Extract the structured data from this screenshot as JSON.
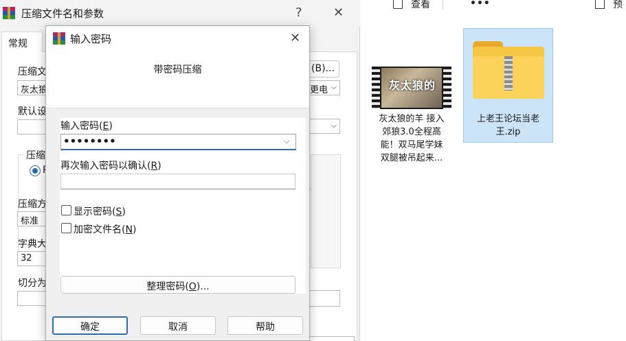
{
  "explorer": {
    "toolbar": {
      "view_label": "查看",
      "more_label": "•••",
      "preview_label": "预"
    },
    "files": [
      {
        "name": "灰太狼的羊 接入郊狼3.0全程高能！双马尾学妹双腿被吊起来...",
        "lines": [
          "灰太狼的羊 接入",
          "郊狼3.0全程高",
          "能！双马尾学妹",
          "双腿被吊起来..."
        ],
        "thumb_text": "灰太狼的"
      },
      {
        "name": "上老王论坛当老王.zip",
        "lines": [
          "上老王论坛当老",
          "王.zip"
        ],
        "selected": true
      }
    ]
  },
  "archive_dialog": {
    "title": "压缩文件名和参数",
    "help_glyph": "?",
    "close_glyph": "✕",
    "tab_general": "常规",
    "archive_name_label": "压缩文",
    "archive_name_value": "灰太狼",
    "browse_label": "(B)...",
    "update_mode_value": "更电",
    "default_profile_label": "默认设",
    "format_group_label": "压缩",
    "format_radio_label": "R",
    "method_label": "压缩方",
    "method_value": "标准",
    "dict_label": "字典大",
    "dict_value": "32",
    "split_label": "切分为",
    "side_letter": ")"
  },
  "password_dialog": {
    "title": "输入密码",
    "close_glyph": "✕",
    "header_text": "带密码压缩",
    "enter_label": "输入密码",
    "enter_hotkey": "E",
    "enter_value": "••••••••",
    "confirm_label": "再次输入密码以确认",
    "confirm_hotkey": "R",
    "confirm_value": "",
    "show_password_label": "显示密码",
    "show_password_hotkey": "S",
    "encrypt_names_label": "加密文件名",
    "encrypt_names_hotkey": "N",
    "organize_label": "整理密码",
    "organize_hotkey": "O",
    "organize_suffix": "...",
    "ok_label": "确定",
    "cancel_label": "取消",
    "help_label": "帮助"
  },
  "colors": {
    "accent": "#2b6cb0",
    "selection": "#cce4f7",
    "folder": "#f6c744"
  }
}
